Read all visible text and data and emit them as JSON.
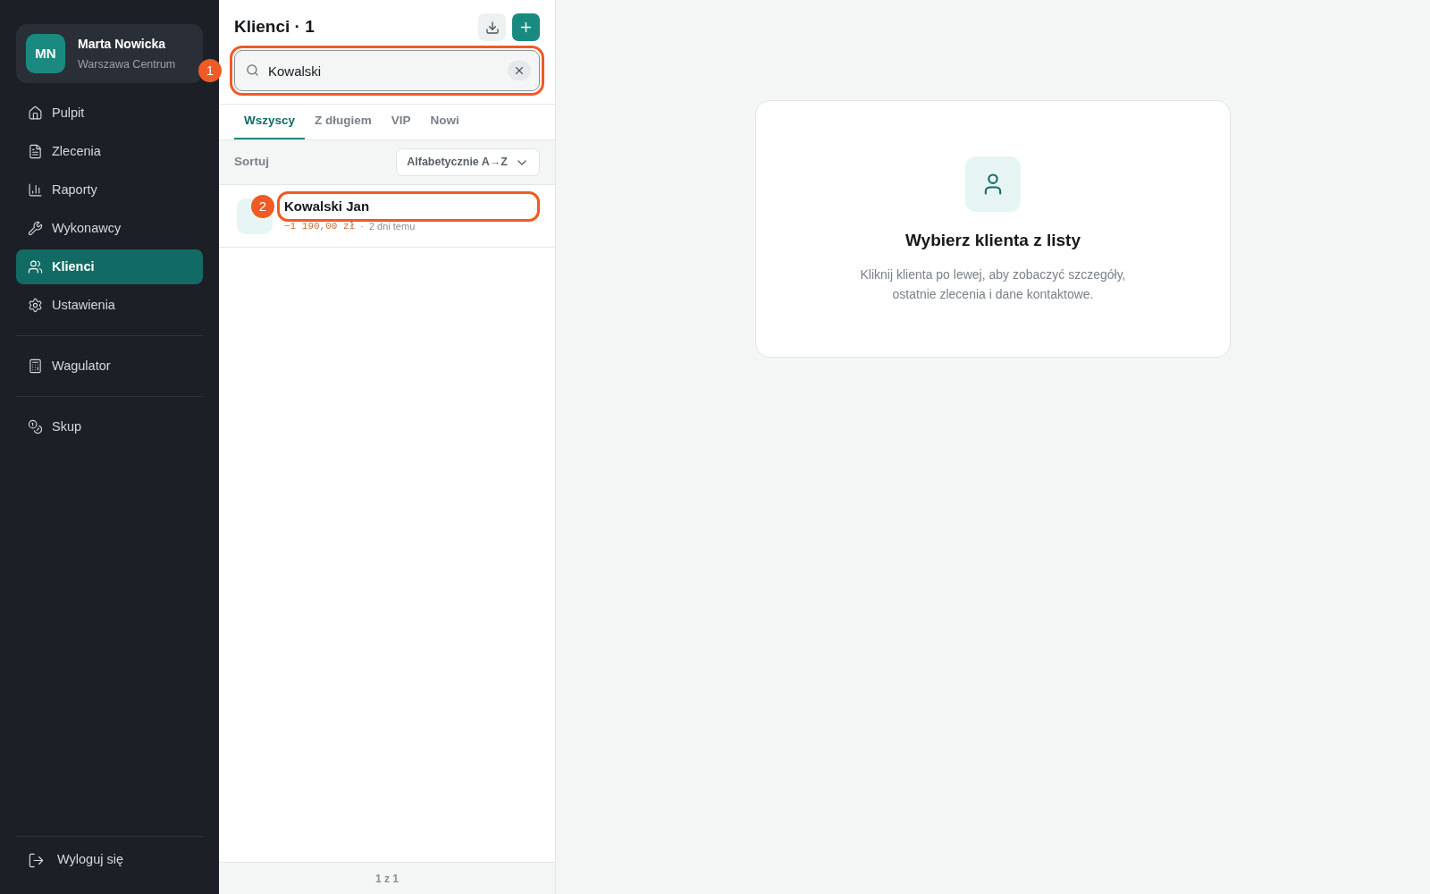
{
  "profile": {
    "initials": "MN",
    "name": "Marta Nowicka",
    "location": "Warszawa Centrum"
  },
  "nav_groups": [
    {
      "items": [
        {
          "label": "Pulpit",
          "kind": "home",
          "selected": false
        },
        {
          "label": "Zlecenia",
          "kind": "file",
          "selected": false
        },
        {
          "label": "Raporty",
          "kind": "chart",
          "selected": false
        },
        {
          "label": "Wykonawcy",
          "kind": "wrench",
          "selected": false
        },
        {
          "label": "Klienci",
          "kind": "users",
          "selected": true
        },
        {
          "label": "Ustawienia",
          "kind": "gear",
          "selected": false
        }
      ]
    },
    {
      "items": [
        {
          "label": "Wagulator",
          "kind": "calculator",
          "selected": false
        }
      ]
    },
    {
      "items": [
        {
          "label": "Skup",
          "kind": "coins",
          "selected": false
        }
      ]
    }
  ],
  "logout": {
    "label": "Wyloguj się"
  },
  "list_panel": {
    "title": "Klienci · 1",
    "search": {
      "value": "Kowalski",
      "annotation": "1"
    },
    "tabs": [
      {
        "label": "Wszyscy",
        "selected": true
      },
      {
        "label": "Z długiem",
        "selected": false
      },
      {
        "label": "VIP",
        "selected": false
      },
      {
        "label": "Nowi",
        "selected": false
      }
    ],
    "sort": {
      "label": "Sortuj",
      "value": "Alfabetycznie A→Z"
    },
    "clients": [
      {
        "name": "Kowalski Jan",
        "balance": "−1 190,00 zł",
        "separator": "·",
        "last_activity": "2 dni temu",
        "annotation": "2"
      }
    ],
    "pagination": "1 z 1"
  },
  "empty_state": {
    "title": "Wybierz klienta z listy",
    "text": "Kliknij klienta po lewej, aby zobaczyć szczegóły, ostatnie zlecenia i dane kontaktowe."
  }
}
